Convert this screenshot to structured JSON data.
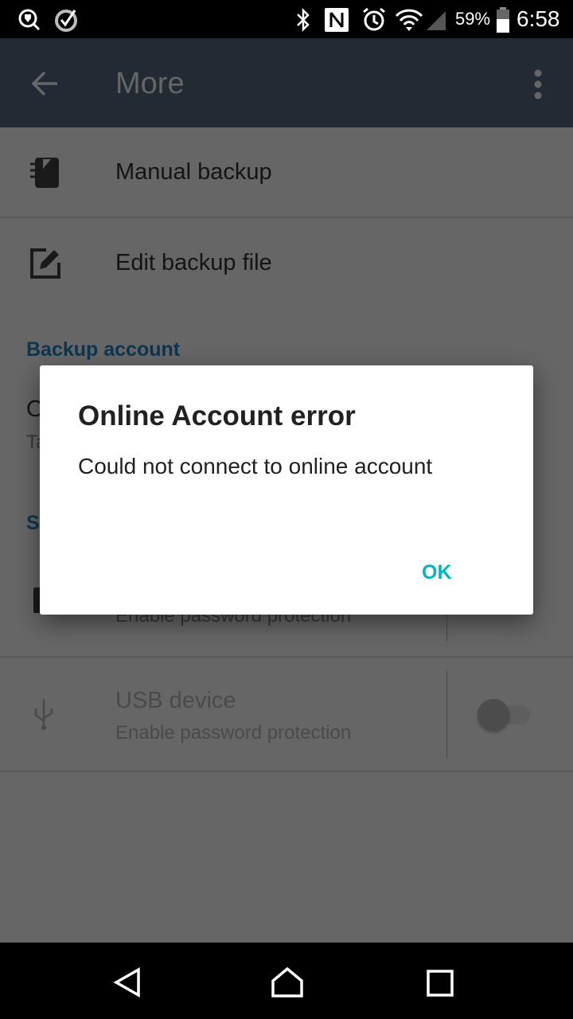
{
  "status_bar": {
    "battery": "59%",
    "time": "6:58",
    "icons": [
      "search-shield-icon",
      "check-circle-icon",
      "bluetooth-icon",
      "nfc-icon",
      "alarm-icon",
      "wifi-icon",
      "signal-icon",
      "battery-icon"
    ]
  },
  "toolbar": {
    "title": "More",
    "back_icon": "arrow-left-icon",
    "menu_icon": "more-vert-icon"
  },
  "list": {
    "manual_backup": "Manual backup",
    "edit_backup_file": "Edit backup file",
    "backup_account_header": "Backup account",
    "online_account_title_partial": "O",
    "online_account_sub_partial": "Ta",
    "security_header_partial": "S",
    "password_sub": "Enable password protection",
    "usb_title": "USB device",
    "usb_sub": "Enable password protection",
    "usb_toggle_on": false
  },
  "dialog": {
    "title": "Online Account error",
    "message": "Could not connect to online account",
    "ok": "OK",
    "accent": "#00b5c1"
  },
  "nav": {
    "back": "back-icon",
    "home": "home-icon",
    "recents": "recents-icon"
  }
}
